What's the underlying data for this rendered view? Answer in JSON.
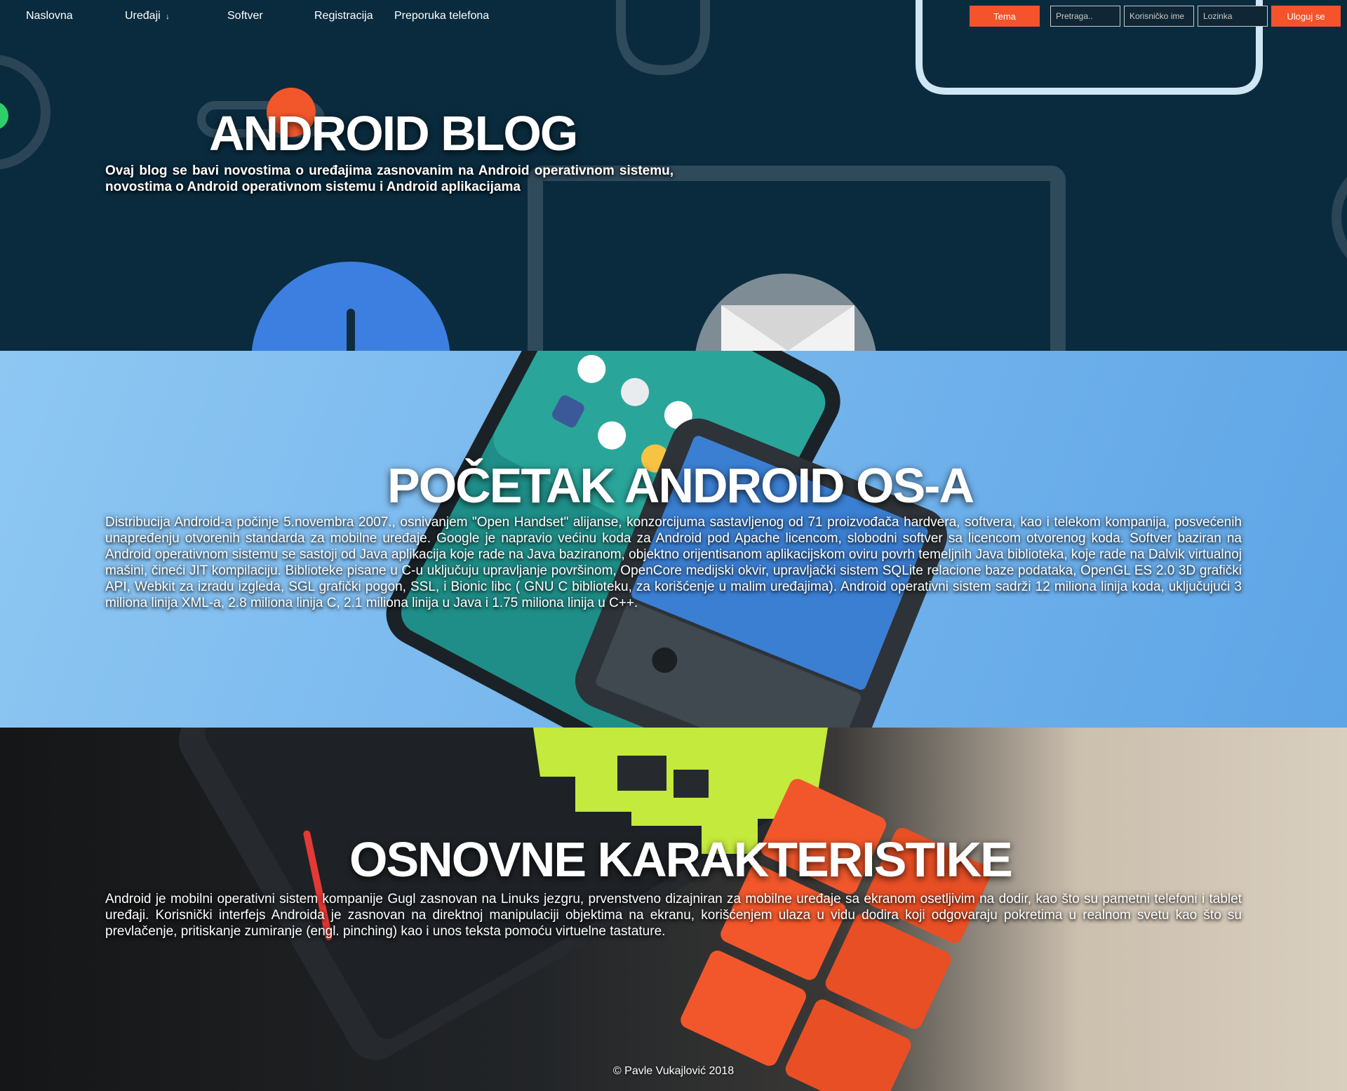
{
  "nav": {
    "items": [
      "Naslovna",
      "Uređaji",
      "Softver",
      "Registracija",
      "Preporuka telefona"
    ],
    "devices_arrow": "↓",
    "theme_button": "Tema",
    "search_placeholder": "Pretraga..",
    "username_placeholder": "Korisničko ime",
    "password_placeholder": "Lozinka",
    "login_button": "Uloguj se",
    "accent_color": "#f4532b"
  },
  "hero": {
    "title": "ANDROID BLOG",
    "subtitle": "Ovaj blog se bavi novostima o uređajima zasnovanim na Android operativnom sistemu, novostima o Android operativnom sistemu i Android aplikacijama"
  },
  "section_start": {
    "title": "POČETAK ANDROID OS-A",
    "text": "Distribucija Android-a počinje 5.novembra 2007., osnivanjem \"Open Handset\" alijanse, konzorcijuma sastavljenog od 71 proizvođača hardvera, softvera, kao i telekom kompanija, posvećenih unapređenju otvorenih standarda za mobilne uređaje. Google je napravio većinu koda za Android pod Apache licencom, slobodni softver sa licencom otvorenog koda. Softver baziran na Android operativnom sistemu se sastoji od Java aplikacija koje rade na Java baziranom, objektno orijentisanom aplikacijskom oviru povrh temeljnih Java biblioteka, koje rade na Dalvik virtualnoj mašini, čineći JIT kompilaciju. Biblioteke pisane u C-u uključuju upravljanje površinom, OpenCore medijski okvir, upravljački sistem SQLite relacione baze podataka, OpenGL ES 2.0 3D grafički API, Webkit za izradu izgleda, SGL grafički pogon, SSL, i Bionic libc ( GNU C biblioteku, za korišćenje u malim uređajima). Android operativni sistem sadrži 12 miliona linija koda, uključujući 3 miliona linija XML-a, 2.8 miliona linija C, 2.1 miliona linija u Java i 1.75 miliona linija u C++."
  },
  "section_features": {
    "title": "OSNOVNE KARAKTERISTIKE",
    "text": "Android je mobilni operativni sistem kompanije Gugl zasnovan na Linuks jezgru, prvenstveno dizajniran za mobilne uređaje sa ekranom osetljivim na dodir, kao što su pametni telefoni i tablet uređaji. Korisnički interfejs Androida je zasnovan na direktnoj manipulaciji objektima na ekranu, korišćenjem ulaza u vidu dodira koji odgovaraju pokretima u realnom svetu kao što su prevlačenje, pritiskanje zumiranje (engl. pinching) kao i unos teksta pomoću virtuelne tastature."
  },
  "footer": {
    "copyright": "© Pavle Vukajlović 2018"
  }
}
